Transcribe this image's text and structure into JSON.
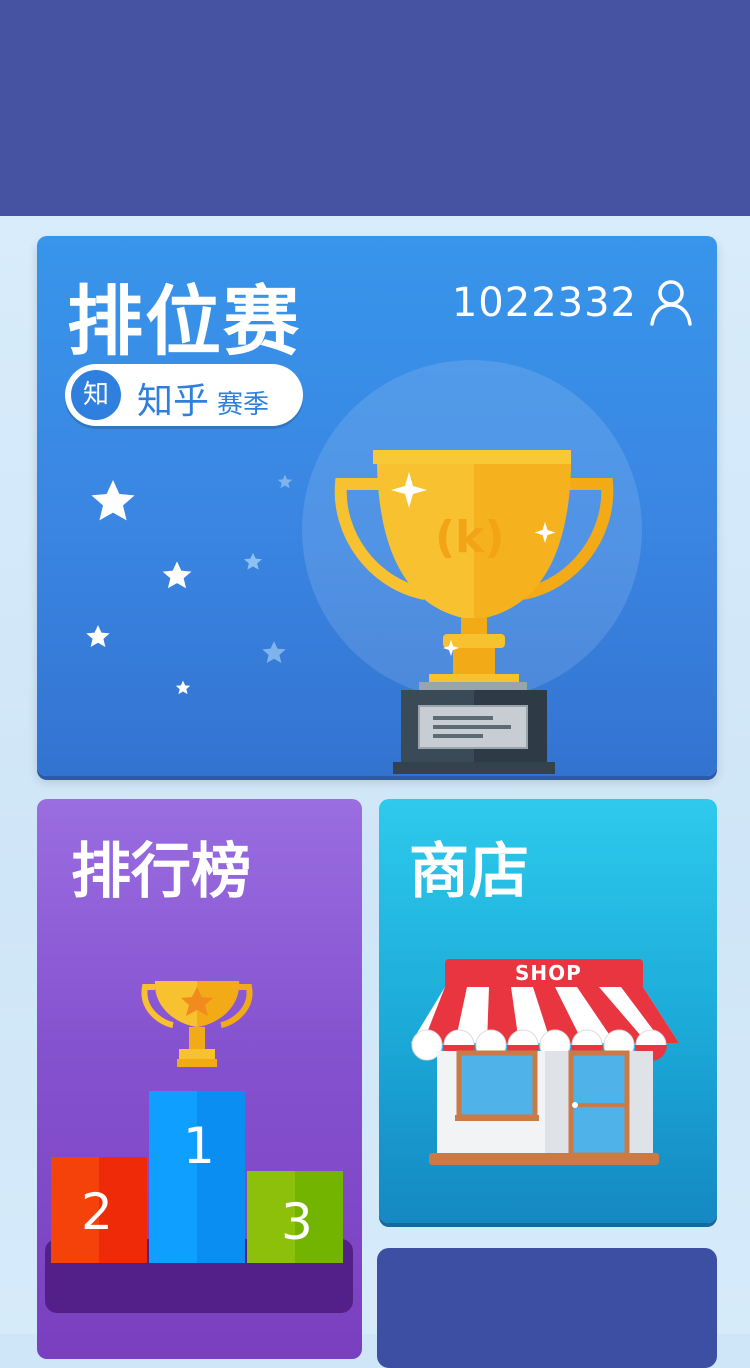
{
  "ranked": {
    "title": "排位赛",
    "user_id": "1022332",
    "season_badge": "知",
    "season_name": "知乎",
    "season_suffix": "赛季",
    "trophy_letter": "(k)"
  },
  "leaderboard": {
    "title": "排行榜",
    "podium": [
      "1",
      "2",
      "3"
    ]
  },
  "shop": {
    "title": "商店",
    "sign": "SHOP"
  },
  "colors": {
    "header": "#4653a3",
    "ranked_card": "#3a85e2",
    "leaderboard_card": "#8552cf",
    "shop_card": "#1ba9d8",
    "accent_gold": "#f7c12f"
  },
  "icons": [
    "user-icon",
    "trophy-icon",
    "podium-icon",
    "shop-icon",
    "star-icon"
  ]
}
